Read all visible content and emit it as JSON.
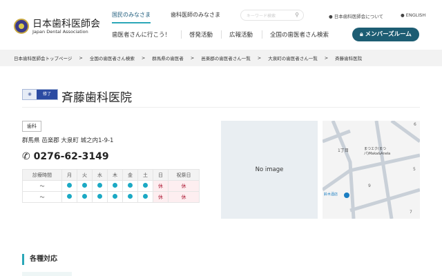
{
  "header": {
    "logo_jp": "日本歯科医師会",
    "logo_en": "Japan Dental Association",
    "nav_top": [
      "国民のみなさま",
      "歯科医師のみなさま"
    ],
    "search_placeholder": "キーワード検索",
    "util_links": [
      "日本歯科医師会について",
      "ENGLISH"
    ],
    "nav_main": [
      "歯医者さんに行こう！",
      "啓発活動",
      "広報活動",
      "全国の歯医者さん検索"
    ],
    "member_button": "メンバーズルーム"
  },
  "breadcrumb": [
    "日本歯科医師会トップページ",
    "全国の歯医者さん検索",
    "群馬県の歯医者",
    "邑楽郡の歯医者さん一覧",
    "大泉町の歯医者さん一覧",
    "斉藤歯科医院"
  ],
  "clinic": {
    "badge": "修了",
    "name": "斉藤歯科医院",
    "category": "歯科",
    "address": "群馬県 邑楽郡 大泉町 城之内1-9-1",
    "phone": "0276-62-3149",
    "schedule": {
      "headers": [
        "診療時間",
        "月",
        "火",
        "水",
        "木",
        "金",
        "土",
        "日",
        "祝祭日"
      ],
      "rows": [
        {
          "time": "〜",
          "days": [
            "●",
            "●",
            "●",
            "●",
            "●",
            "●",
            "休",
            "休"
          ]
        },
        {
          "time": "〜",
          "days": [
            "●",
            "●",
            "●",
            "●",
            "●",
            "●",
            "休",
            "休"
          ]
        }
      ]
    },
    "no_image": "No image"
  },
  "map": {
    "labels": [
      "1丁目",
      "まつエク(まつパ)Maka&Anela",
      "鈴木酒店",
      "9",
      "5",
      "6",
      "7"
    ]
  },
  "section": {
    "title": "各種対応"
  },
  "colors": {
    "accent": "#2aa7b8",
    "member": "#1d5d73",
    "open_dot": "#1ba9c4",
    "closed": "#b0203a"
  }
}
